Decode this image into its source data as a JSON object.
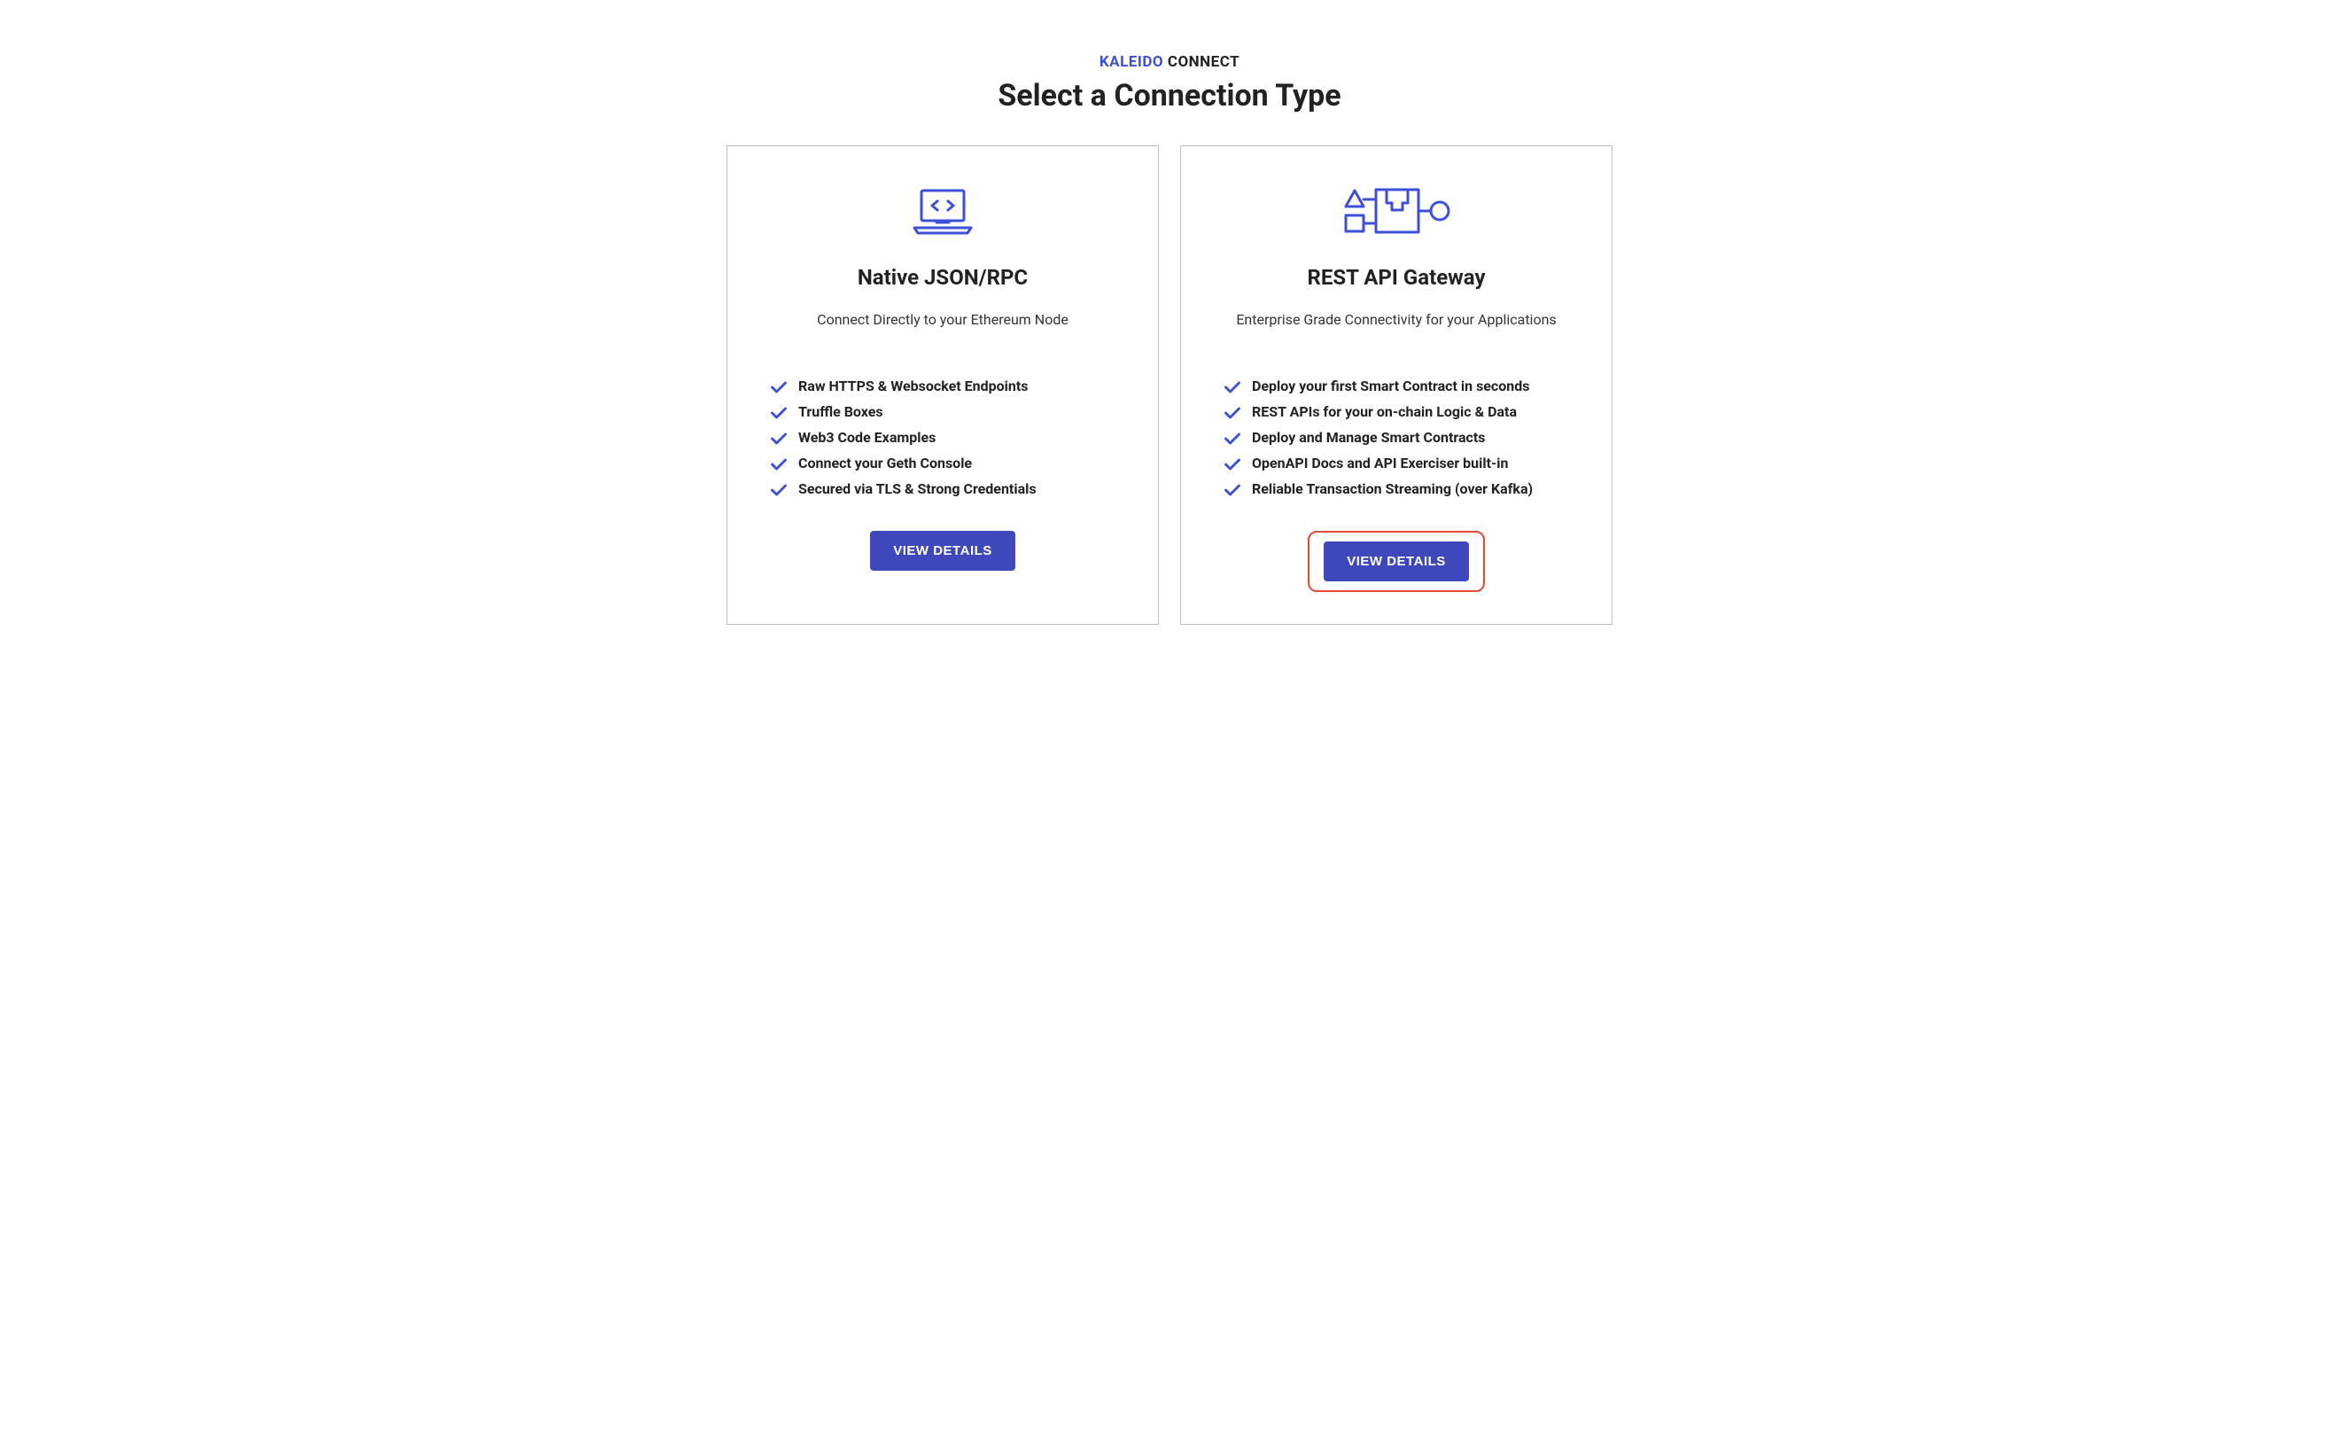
{
  "header": {
    "eyebrow_brand": "KALEIDO",
    "eyebrow_rest": " CONNECT",
    "title": "Select a Connection Type"
  },
  "cards": [
    {
      "icon": "laptop-code-icon",
      "title": "Native JSON/RPC",
      "subtitle": "Connect Directly to your Ethereum Node",
      "features": [
        "Raw HTTPS & Websocket Endpoints",
        "Truffle Boxes",
        "Web3 Code Examples",
        "Connect your Geth Console",
        "Secured via TLS & Strong Credentials"
      ],
      "button_label": "VIEW DETAILS",
      "highlighted": false
    },
    {
      "icon": "shapes-plug-icon",
      "title": "REST API Gateway",
      "subtitle": "Enterprise Grade Connectivity for your Applications",
      "features": [
        "Deploy your first Smart Contract in seconds",
        "REST APIs for your on-chain Logic & Data",
        "Deploy and Manage Smart Contracts",
        "OpenAPI Docs and API Exerciser built-in",
        "Reliable Transaction Streaming (over Kafka)"
      ],
      "button_label": "VIEW DETAILS",
      "highlighted": true
    }
  ],
  "colors": {
    "accent": "#3c4fd8",
    "button": "#3f48ba",
    "highlight_border": "#e64a33"
  }
}
